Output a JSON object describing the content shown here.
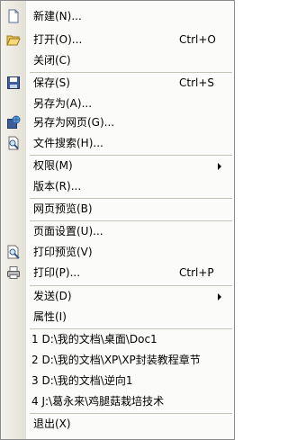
{
  "menu": {
    "items": {
      "new": {
        "label": "新建(N)..."
      },
      "open": {
        "label": "打开(O)...",
        "shortcut": "Ctrl+O"
      },
      "close": {
        "label": "关闭(C)"
      },
      "save": {
        "label": "保存(S)",
        "shortcut": "Ctrl+S"
      },
      "save_as": {
        "label": "另存为(A)..."
      },
      "save_as_web": {
        "label": "另存为网页(G)..."
      },
      "file_search": {
        "label": "文件搜索(H)..."
      },
      "permission": {
        "label": "权限(M)"
      },
      "version": {
        "label": "版本(R)..."
      },
      "web_preview": {
        "label": "网页预览(B)"
      },
      "page_setup": {
        "label": "页面设置(U)..."
      },
      "print_preview": {
        "label": "打印预览(V)"
      },
      "print": {
        "label": "打印(P)...",
        "shortcut": "Ctrl+P"
      },
      "send_to": {
        "label": "发送(D)"
      },
      "properties": {
        "label": "属性(I)"
      },
      "recent_1": {
        "label": "1 D:\\我的文档\\桌面\\Doc1"
      },
      "recent_2": {
        "label": "2 D:\\我的文档\\XP\\XP封装教程章节"
      },
      "recent_3": {
        "label": "3 D:\\我的文档\\逆向1"
      },
      "recent_4": {
        "label": "4 J:\\葛永来\\鸡腿菇栽培技术"
      },
      "exit": {
        "label": "退出(X)"
      }
    }
  },
  "icons": {
    "new": "new-document-icon",
    "open": "open-folder-icon",
    "save": "save-disk-icon",
    "save_as_web": "save-as-web-icon",
    "file_search": "file-search-icon",
    "print_preview": "print-preview-icon",
    "print": "printer-icon"
  },
  "colors": {
    "menu_background": "#fbfbf9",
    "gutter": "#e3e0d6",
    "separator": "#c5c2b8"
  }
}
